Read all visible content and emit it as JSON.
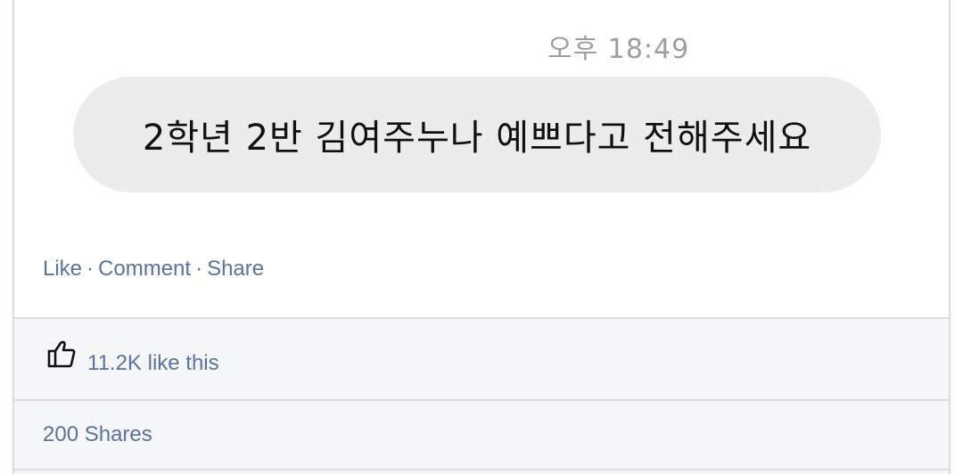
{
  "post": {
    "image": {
      "timestamp": "오후 18:49",
      "message": "2학년 2반 김여주누나 예쁘다고 전해주세요"
    },
    "actions": {
      "like_label": "Like",
      "comment_label": "Comment",
      "share_label": "Share",
      "separator": "·"
    },
    "stats": {
      "likes_text": "11.2K like this",
      "shares_text": "200 Shares"
    }
  },
  "icons": {
    "likes": "thumbs-up-icon"
  },
  "colors": {
    "link": "#5b73a0",
    "bubble": "#ececec",
    "row_background": "#f5f6f7",
    "border": "#dadde1"
  }
}
